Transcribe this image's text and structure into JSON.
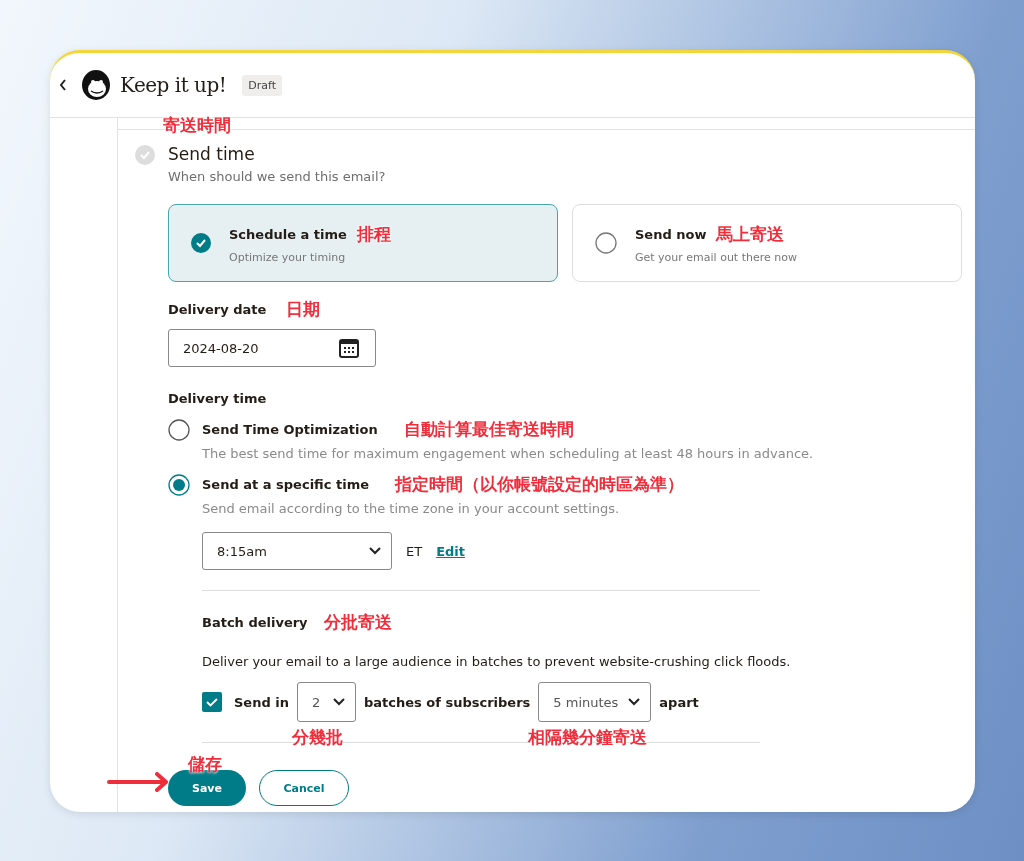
{
  "header": {
    "title": "Keep it up!",
    "badge": "Draft"
  },
  "section": {
    "annotation": "寄送時間",
    "title": "Send time",
    "subtitle": "When should we send this email?"
  },
  "options": [
    {
      "title": "Schedule a time",
      "subtitle": "Optimize your timing",
      "annotation": "排程",
      "selected": true
    },
    {
      "title": "Send now",
      "subtitle": "Get your email out there now",
      "annotation": "馬上寄送",
      "selected": false
    }
  ],
  "delivery_date": {
    "label": "Delivery date",
    "annotation": "日期",
    "value": "2024-08-20"
  },
  "delivery_time": {
    "label": "Delivery time",
    "choices": [
      {
        "title": "Send Time Optimization",
        "annotation": "自動計算最佳寄送時間",
        "description": "The best send time for maximum engagement when scheduling at least 48 hours in advance.",
        "selected": false
      },
      {
        "title": "Send at a specific time",
        "annotation": "指定時間（以你帳號設定的時區為準）",
        "description": "Send email according to the time zone in your account settings.",
        "selected": true
      }
    ],
    "time": "8:15am",
    "zone": "ET",
    "edit": "Edit"
  },
  "batch": {
    "title": "Batch delivery",
    "annotation": "分批寄送",
    "description": "Deliver your email to a large audience in batches to prevent website-crushing click floods.",
    "checked": true,
    "send_in": "Send in",
    "batches": "2",
    "batches_annotation": "分幾批",
    "middle": "batches of subscribers",
    "interval": "5 minutes",
    "interval_annotation": "相隔幾分鐘寄送",
    "apart": "apart"
  },
  "buttons": [
    {
      "label": "Save",
      "kind": "primary",
      "annotation": "儲存"
    },
    {
      "label": "Cancel",
      "kind": "secondary"
    }
  ]
}
